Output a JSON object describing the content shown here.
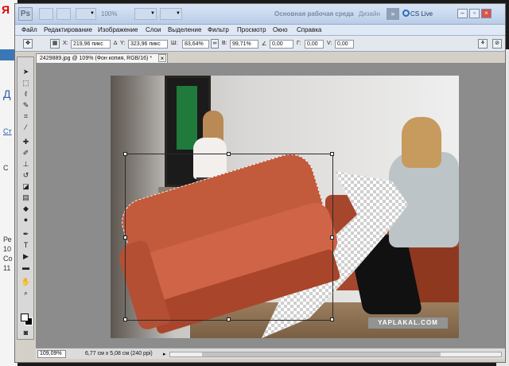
{
  "titlebar": {
    "app_logo": "Ps",
    "zoom_value": "100%",
    "workspace_main": "Основная рабочая среда",
    "workspace_design": "Дизайн",
    "more_label": "»",
    "cs_live": "CS Live"
  },
  "menu": [
    "Файл",
    "Редактирование",
    "Изображение",
    "Слои",
    "Выделение",
    "Фильтр",
    "Просмотр",
    "Окно",
    "Справка"
  ],
  "options": {
    "x_label": "X:",
    "x_value": "219,96 пикс",
    "y_label": "Y:",
    "y_value": "323,96 пикс",
    "w_label": "Ш:",
    "w_value": "83,64%",
    "h_label": "В:",
    "h_value": "99,71%",
    "angle_value": "0,00",
    "hskew_label": "Г:",
    "hskew_value": "0,00",
    "vskew_label": "V:",
    "vskew_value": "0,00"
  },
  "document": {
    "tab_title": "2429889.jpg @ 109% (Фон копия, RGB/16) *",
    "tab_close": "×",
    "watermark": "YAPLAKAL.COM"
  },
  "status": {
    "zoom": "109,09%",
    "doc_size": "6,77 см x 5,08 см (240 ppi)",
    "arrow": "▸"
  },
  "browser": {
    "logo_fragment": "Я",
    "text_fragments": [
      "Д",
      "Ст",
      "С",
      "Ре",
      "10",
      "Со",
      "11"
    ]
  },
  "icons": {
    "move": "move-icon",
    "marquee": "marquee-icon",
    "lasso": "lasso-icon",
    "quick-select": "quick-select-icon",
    "crop": "crop-icon",
    "eyedropper": "eyedropper-icon",
    "healing": "healing-brush-icon",
    "brush": "brush-icon",
    "stamp": "clone-stamp-icon",
    "history-brush": "history-brush-icon",
    "eraser": "eraser-icon",
    "gradient": "gradient-icon",
    "blur": "blur-icon",
    "dodge": "dodge-icon",
    "pen": "pen-icon",
    "type": "type-icon",
    "path-select": "path-select-icon",
    "shape": "shape-icon",
    "hand": "hand-icon",
    "zoom": "zoom-icon"
  },
  "colors": {
    "foreground": "#ffffff",
    "background": "#000000",
    "titlebar": "#c9d8ee"
  }
}
